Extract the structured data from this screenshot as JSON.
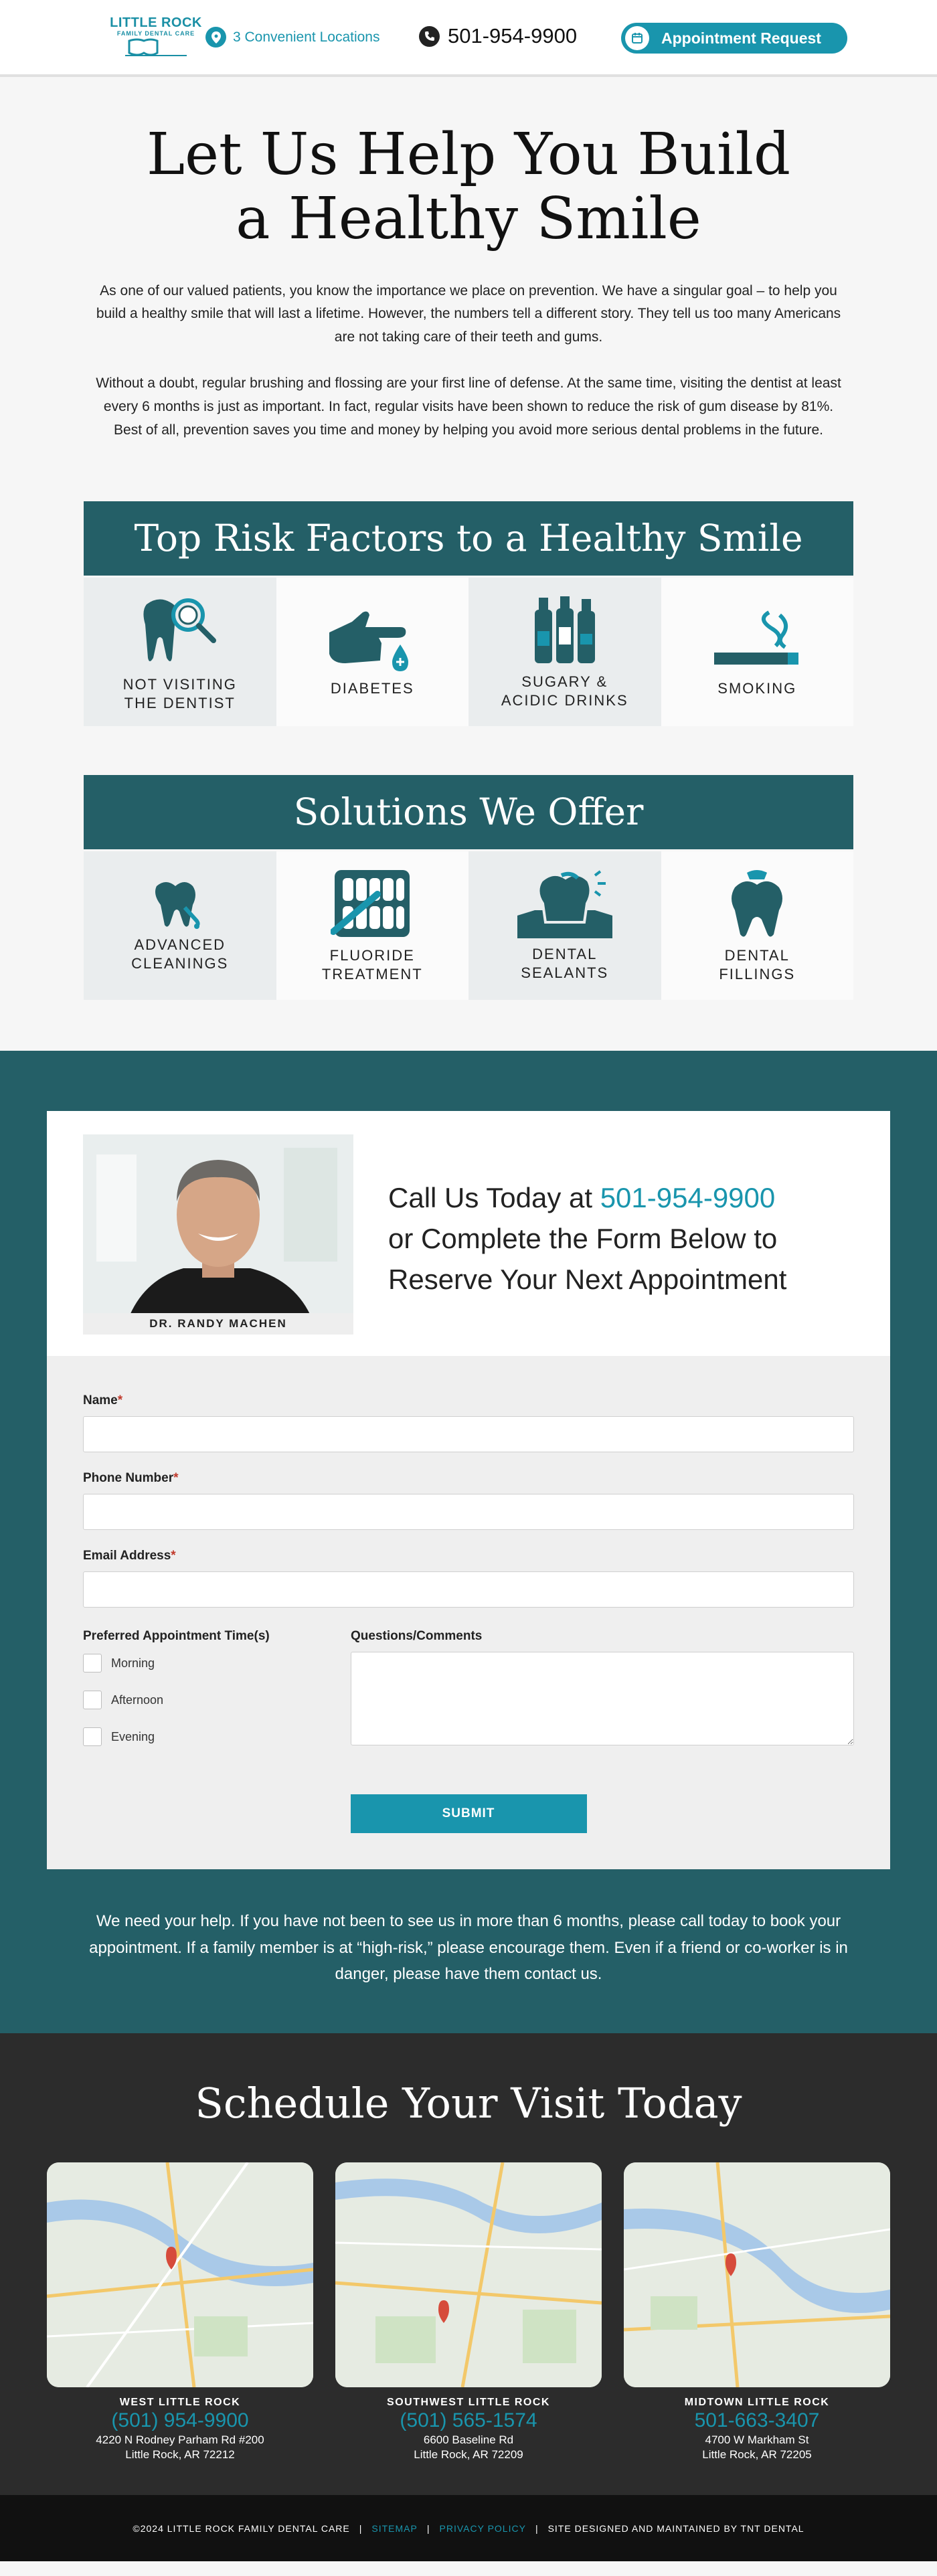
{
  "header": {
    "logo_line1": "LITTLE ROCK",
    "logo_line2": "FAMILY DENTAL CARE",
    "locations_label": "3 Convenient Locations",
    "phone": "501-954-9900",
    "appointment_label": "Appointment Request"
  },
  "intro": {
    "title_line1": "Let Us Help You Build",
    "title_line2": "a Healthy Smile",
    "paragraph1": "As one of our valued patients, you know the importance we place on prevention. We have a singular goal – to help you build a healthy smile that will last a lifetime.  However, the numbers tell a different story. They tell us too many Americans are not taking care of their teeth and gums.",
    "paragraph2": "Without a doubt, regular brushing and flossing are your first line of defense. At the same time,  visiting the dentist at least every 6 months is just as important. In fact, regular visits have been shown to reduce the risk of gum disease by 81%. Best of all, prevention saves you time and money by helping you avoid more serious dental problems in the future."
  },
  "risk_factors": {
    "title": "Top Risk Factors to a Healthy Smile",
    "items": [
      {
        "label": "NOT VISITING THE DENTIST",
        "icon": "tooth-magnifier-icon"
      },
      {
        "label": "DIABETES",
        "icon": "blood-drop-finger-icon"
      },
      {
        "label": "SUGARY & ACIDIC DRINKS",
        "icon": "bottles-icon"
      },
      {
        "label": "SMOKING",
        "icon": "cigarette-icon"
      }
    ]
  },
  "solutions": {
    "title": "Solutions We Offer",
    "items": [
      {
        "label": "ADVANCED CLEANINGS",
        "icon": "tooth-cleaning-icon"
      },
      {
        "label": "FLUORIDE TREATMENT",
        "icon": "teeth-brush-icon"
      },
      {
        "label": "DENTAL SEALANTS",
        "icon": "tooth-sealant-icon"
      },
      {
        "label": "DENTAL FILLINGS",
        "icon": "tooth-filling-icon"
      }
    ]
  },
  "contact": {
    "doctor_name": "DR. RANDY MACHEN",
    "call_prefix": "Call Us Today at ",
    "call_phone": "501-954-9900",
    "call_line2": "or Complete the Form Below to",
    "call_line3": "Reserve Your Next Appointment",
    "form": {
      "name_label": "Name",
      "phone_label": "Phone Number",
      "email_label": "Email Address",
      "required_mark": "*",
      "time_label": "Preferred Appointment Time(s)",
      "options": [
        "Morning",
        "Afternoon",
        "Evening"
      ],
      "comments_label": "Questions/Comments",
      "submit_label": "SUBMIT"
    },
    "note": "We need your help. If you have not been to see us in more than 6 months, please call today to book your appointment. If a family member is at “high-risk,” please encourage them. Even if a friend or co-worker is in danger, please have them contact us."
  },
  "schedule": {
    "title": "Schedule Your Visit Today",
    "locations": [
      {
        "name": "WEST LITTLE ROCK",
        "phone": "(501) 954-9900",
        "address1": "4220 N Rodney Parham Rd #200",
        "address2": "Little Rock, AR 72212"
      },
      {
        "name": "SOUTHWEST LITTLE ROCK",
        "phone": "(501) 565-1574",
        "address1": "6600 Baseline Rd",
        "address2": "Little Rock, AR 72209"
      },
      {
        "name": "MIDTOWN LITTLE ROCK",
        "phone": "501-663-3407",
        "address1": "4700 W Markham St",
        "address2": "Little Rock, AR 72205"
      }
    ],
    "map_label": "Little Rock"
  },
  "footer": {
    "copyright": "©2024 LITTLE ROCK FAMILY DENTAL CARE",
    "sep": "|",
    "sitemap": "SITEMAP",
    "privacy": "PRIVACY POLICY",
    "credit": "SITE DESIGNED AND MAINTAINED BY TNT DENTAL"
  },
  "colors": {
    "accent": "#1995ad",
    "teal_dark": "#245f67",
    "dark_bg": "#2c2c2c",
    "footer_bg": "#111111"
  }
}
